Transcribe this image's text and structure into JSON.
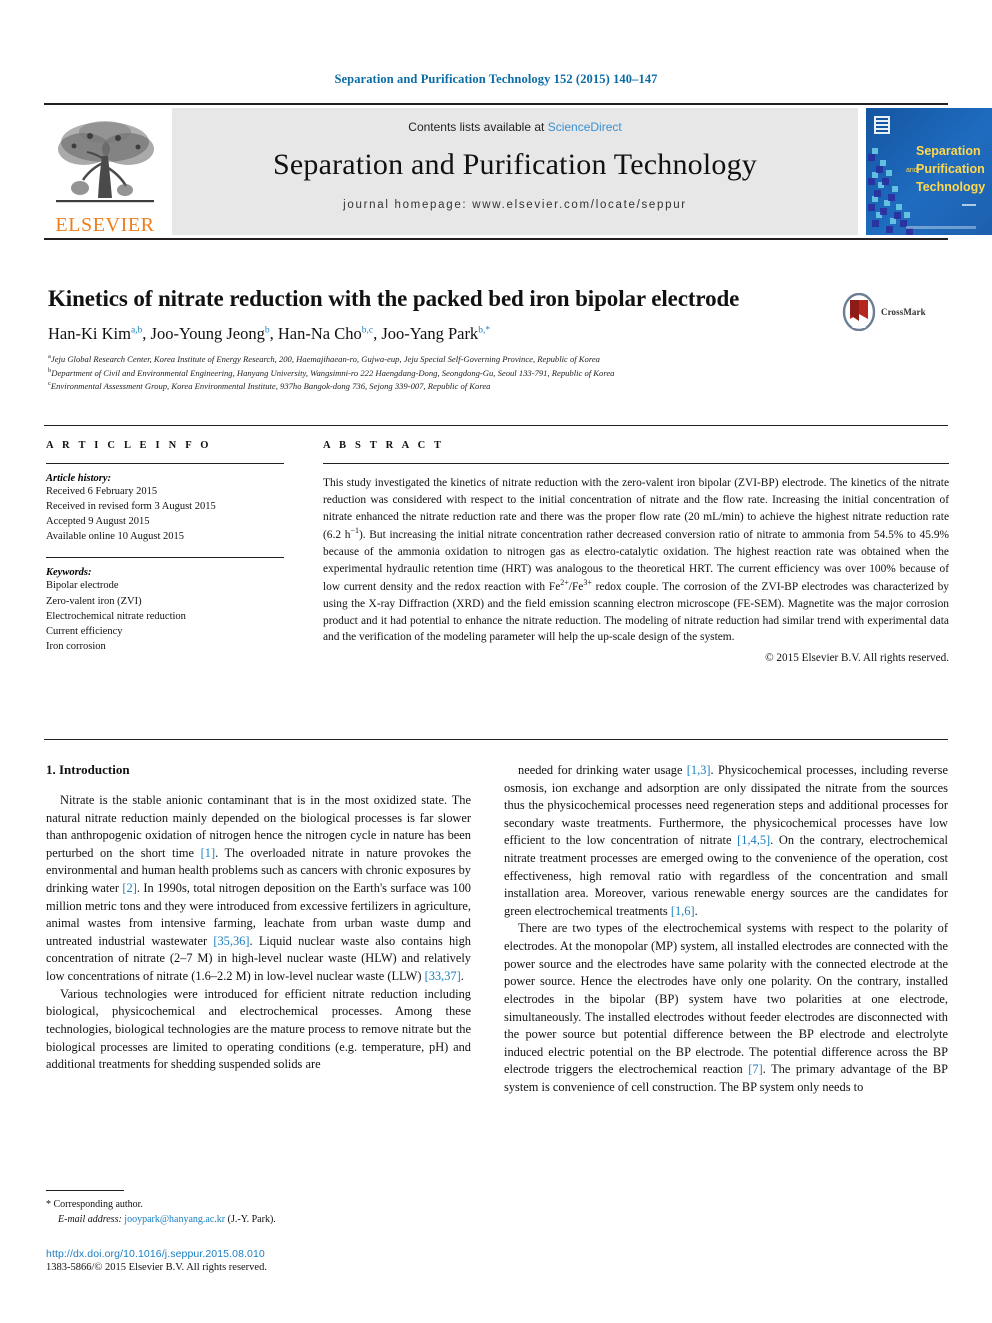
{
  "running_head": "Separation and Purification Technology 152 (2015) 140–147",
  "masthead": {
    "publisher_name": "ELSEVIER",
    "contents_prefix": "Contents lists available at ",
    "contents_link": "ScienceDirect",
    "journal_title": "Separation and Purification Technology",
    "homepage_line": "journal homepage: www.elsevier.com/locate/seppur",
    "cover_title_line1": "Separation",
    "cover_title_line2": "Purification",
    "cover_title_line3": "Technology",
    "cover_amp": "and"
  },
  "article": {
    "title": "Kinetics of nitrate reduction with the packed bed iron bipolar electrode",
    "crossmark_label": "CrossMark",
    "authors": [
      {
        "name": "Han-Ki Kim",
        "sup": "a,b"
      },
      {
        "name": "Joo-Young Jeong",
        "sup": "b"
      },
      {
        "name": "Han-Na Cho",
        "sup": "b,c"
      },
      {
        "name": "Joo-Yang Park",
        "sup": "b,*"
      }
    ],
    "affiliations": [
      {
        "mark": "a",
        "text": "Jeju Global Research Center, Korea Institute of Energy Research, 200, Haemajihaean-ro, Gujwa-eup, Jeju Special Self-Governing Province, Republic of Korea"
      },
      {
        "mark": "b",
        "text": "Department of Civil and Environmental Engineering, Hanyang University, Wangsimni-ro 222 Haengdang-Dong, Seongdong-Gu, Seoul 133-791, Republic of Korea"
      },
      {
        "mark": "c",
        "text": "Environmental Assessment Group, Korea Environmental Institute, 937ho Bangok-dong 736, Sejong 339-007, Republic of Korea"
      }
    ]
  },
  "article_info": {
    "heading": "A R T I C L E   I N F O",
    "history_label": "Article history:",
    "history": [
      "Received 6 February 2015",
      "Received in revised form 3 August 2015",
      "Accepted 9 August 2015",
      "Available online 10 August 2015"
    ],
    "keywords_label": "Keywords:",
    "keywords": [
      "Bipolar electrode",
      "Zero-valent iron (ZVI)",
      "Electrochemical nitrate reduction",
      "Current efficiency",
      "Iron corrosion"
    ]
  },
  "abstract": {
    "heading": "A B S T R A C T",
    "part1": "This study investigated the kinetics of nitrate reduction with the zero-valent iron bipolar (ZVI-BP) electrode. The kinetics of the nitrate reduction was considered with respect to the initial concentration of nitrate and the flow rate. Increasing the initial concentration of nitrate enhanced the nitrate reduction rate and there was the proper flow rate (20 mL/min) to achieve the highest nitrate reduction rate (6.2 h",
    "exp1": "−1",
    "part2": "). But increasing the initial nitrate concentration rather decreased conversion ratio of nitrate to ammonia from 54.5% to 45.9% because of the ammonia oxidation to nitrogen gas as electro-catalytic oxidation. The highest reaction rate was obtained when the experimental hydraulic retention time (HRT) was analogous to the theoretical HRT. The current efficiency was over 100% because of low current density and the redox reaction with Fe",
    "exp2": "2+",
    "part3": "/Fe",
    "exp3": "3+",
    "part4": " redox couple. The corrosion of the ZVI-BP electrodes was characterized by using the X-ray Diffraction (XRD) and the field emission scanning electron microscope (FE-SEM). Magnetite was the major corrosion product and it had potential to enhance the nitrate reduction. The modeling of nitrate reduction had similar trend with experimental data and the verification of the modeling parameter will help the up-scale design of the system.",
    "copyright": "© 2015 Elsevier B.V. All rights reserved."
  },
  "body": {
    "section_heading": "1. Introduction",
    "left_paragraphs": [
      "Nitrate is the stable anionic contaminant that is in the most oxidized state. The natural nitrate reduction mainly depended on the biological processes is far slower than anthropogenic oxidation of nitrogen hence the nitrogen cycle in nature has been perturbed on the short time [1]. The overloaded nitrate in nature provokes the environmental and human health problems such as cancers with chronic exposures by drinking water [2]. In 1990s, total nitrogen deposition on the Earth's surface was 100 million metric tons and they were introduced from excessive fertilizers in agriculture, animal wastes from intensive farming, leachate from urban waste dump and untreated industrial wastewater [35,36]. Liquid nuclear waste also contains high concentration of nitrate (2–7 M) in high-level nuclear waste (HLW) and relatively low concentrations of nitrate (1.6–2.2 M) in low-level nuclear waste (LLW) [33,37].",
      "Various technologies were introduced for efficient nitrate reduction including biological, physicochemical and electrochemical processes. Among these technologies, biological technologies are the mature process to remove nitrate but the biological processes are limited to operating conditions (e.g. temperature, pH) and additional treatments for shedding suspended solids are"
    ],
    "right_paragraphs": [
      "needed for drinking water usage [1,3]. Physicochemical processes, including reverse osmosis, ion exchange and adsorption are only dissipated the nitrate from the sources thus the physicochemical processes need regeneration steps and additional processes for secondary waste treatments. Furthermore, the physicochemical processes have low efficient to the low concentration of nitrate [1,4,5]. On the contrary, electrochemical nitrate treatment processes are emerged owing to the convenience of the operation, cost effectiveness, high removal ratio with regardless of the concentration and small installation area. Moreover, various renewable energy sources are the candidates for green electrochemical treatments [1,6].",
      "There are two types of the electrochemical systems with respect to the polarity of electrodes. At the monopolar (MP) system, all installed electrodes are connected with the power source and the electrodes have same polarity with the connected electrode at the power source. Hence the electrodes have only one polarity. On the contrary, installed electrodes in the bipolar (BP) system have two polarities at one electrode, simultaneously. The installed electrodes without feeder electrodes are disconnected with the power source but potential difference between the BP electrode and electrolyte induced electric potential on the BP electrode. The potential difference across the BP electrode triggers the electrochemical reaction [7]. The primary advantage of the BP system is convenience of cell construction. The BP system only needs to"
    ]
  },
  "footnote": {
    "corresponding_mark": "*",
    "corresponding_text": "Corresponding author.",
    "email_label": "E-mail address:",
    "email": "jooypark@hanyang.ac.kr",
    "email_owner": "(J.-Y. Park)."
  },
  "footer": {
    "doi": "http://dx.doi.org/10.1016/j.seppur.2015.08.010",
    "issn_line": "1383-5866/© 2015 Elsevier B.V. All rights reserved."
  },
  "colors": {
    "link": "#1a7fc1",
    "running_head": "#0b6ba4",
    "elsevier_orange": "#ef7d1a",
    "band_gray": "#e7e7e7"
  }
}
